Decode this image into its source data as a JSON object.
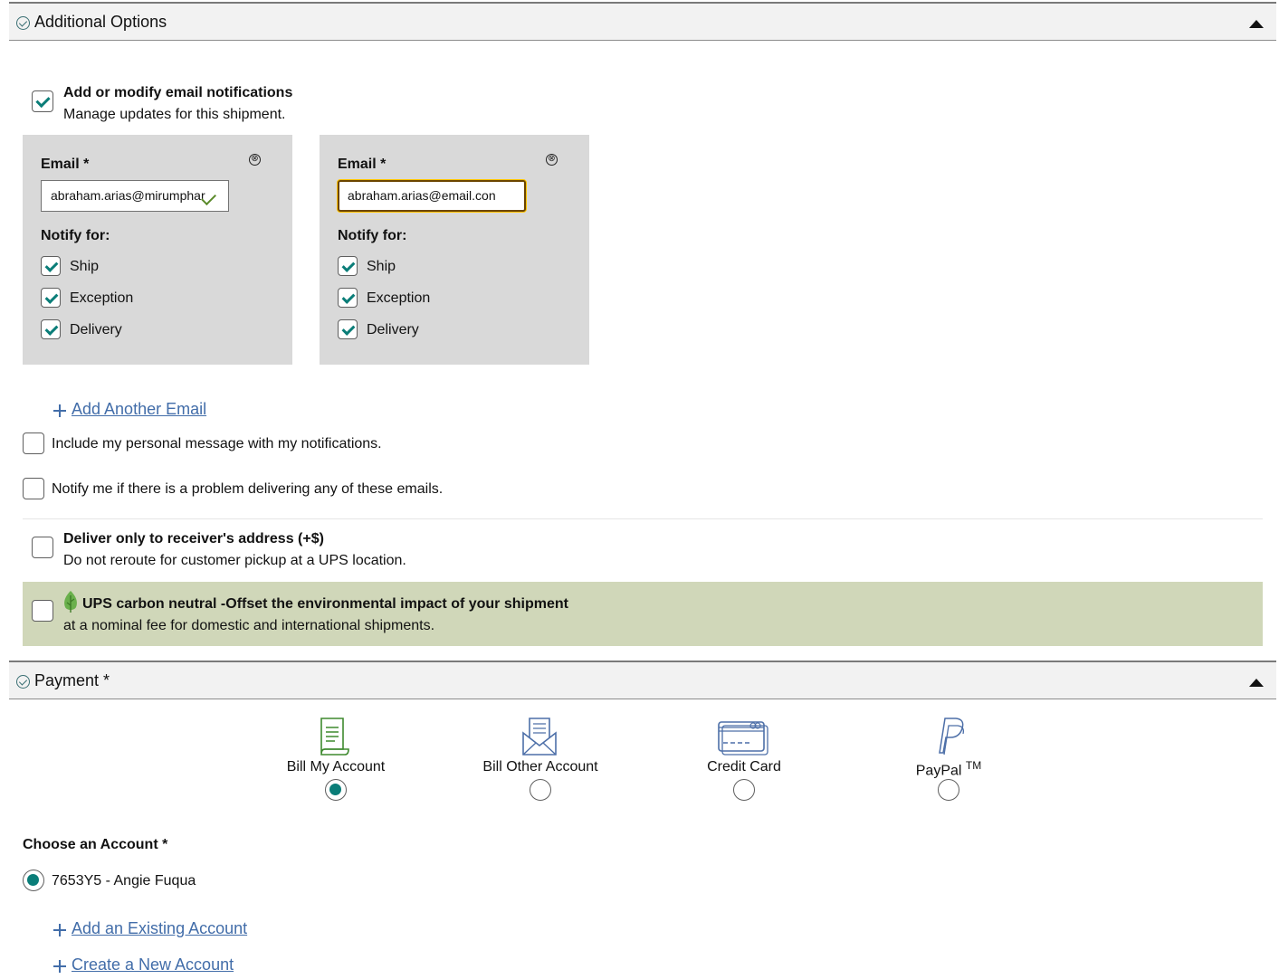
{
  "additional_options": {
    "title": "Additional Options",
    "email_notifications": {
      "checked": true,
      "label": "Add or modify email notifications",
      "description": "Manage updates for this shipment."
    },
    "email_cards": [
      {
        "email_label": "Email *",
        "email_value": "abraham.arias@mirumphar",
        "notify_label": "Notify for:",
        "options": [
          "Ship",
          "Exception",
          "Delivery"
        ]
      },
      {
        "email_label": "Email *",
        "email_value": "abraham.arias@email.con",
        "notify_label": "Notify for:",
        "options": [
          "Ship",
          "Exception",
          "Delivery"
        ]
      }
    ],
    "close_glyph": "⊗",
    "add_another_email": "Add Another Email",
    "personal_message": "Include my personal message with my notifications.",
    "notify_problem": "Notify me if there is a problem delivering any of these emails.",
    "deliver_only": {
      "label": "Deliver only to receiver's address (+$)",
      "description": "Do not reroute for customer pickup at a UPS location."
    },
    "carbon_neutral": {
      "label": "UPS carbon neutral -Offset the environmental impact of your shipment",
      "description": "at a nominal fee for domestic and international shipments."
    }
  },
  "payment": {
    "title": "Payment *",
    "methods": [
      {
        "label": "Bill My Account",
        "selected": true,
        "icon": "bill-document-icon"
      },
      {
        "label": "Bill Other Account",
        "selected": false,
        "icon": "envelope-letter-icon"
      },
      {
        "label": "Credit Card",
        "selected": false,
        "icon": "credit-card-icon"
      },
      {
        "label": "PayPal",
        "superscript": "TM",
        "selected": false,
        "icon": "paypal-icon"
      }
    ],
    "choose_account_label": "Choose an Account *",
    "accounts": [
      {
        "label": "7653Y5 - Angie Fuqua",
        "selected": true
      }
    ],
    "add_existing_account": "Add an Existing Account",
    "create_new_account": "Create a New Account"
  },
  "colors": {
    "accent_teal": "#0a7d78",
    "link_blue": "#426da9",
    "card_gray": "#d9d9d9",
    "carbon_green_bg": "#d0d7b9"
  }
}
